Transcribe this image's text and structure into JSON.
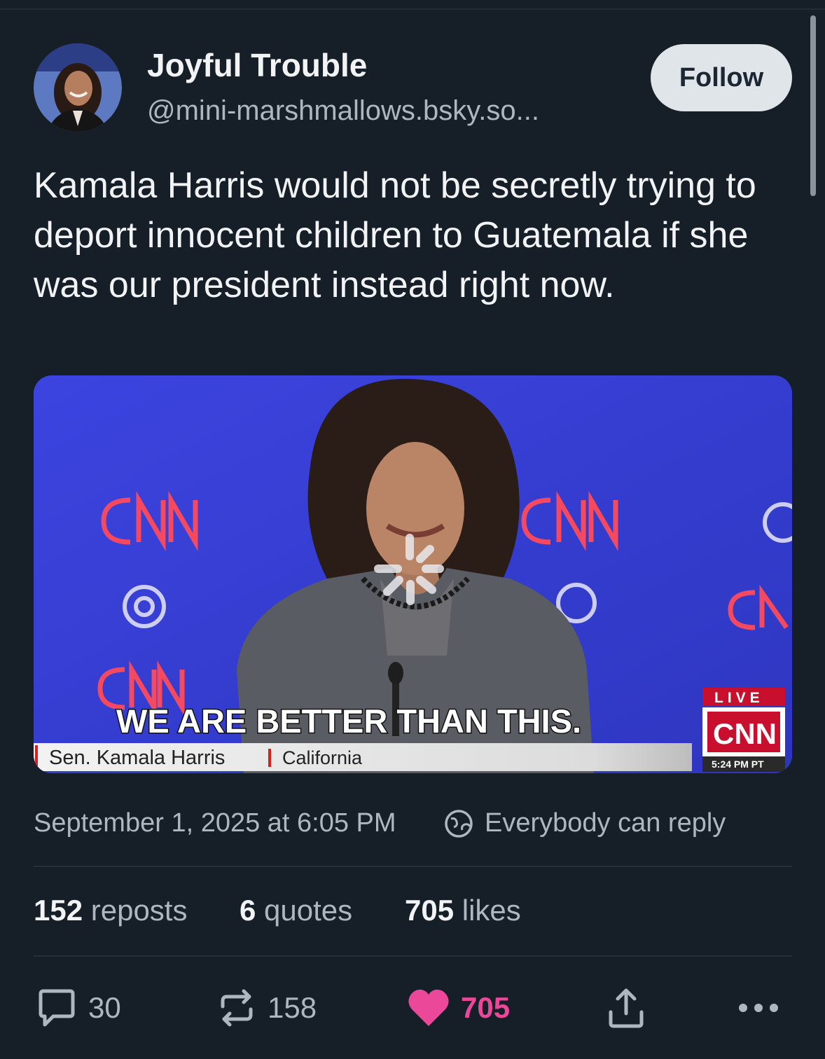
{
  "post": {
    "author_name": "Joyful Trouble",
    "author_handle": "@mini-marshmallows.bsky.so...",
    "follow_label": "Follow",
    "text": "Kamala Harris would not be secretly trying to deport innocent children to Guatemala if she was our president instead right now.",
    "timestamp": "September 1, 2025 at 6:05 PM",
    "reply_setting": "Everybody can reply"
  },
  "media": {
    "caption": "WE ARE BETTER THAN THIS.",
    "chyron_name": "Sen. Kamala Harris",
    "chyron_location": "California",
    "live_label": "LIVE",
    "network_logo": "CNN",
    "time_label": "5:24 PM PT"
  },
  "stats": {
    "reposts_count": "152",
    "reposts_label": "reposts",
    "quotes_count": "6",
    "quotes_label": "quotes",
    "likes_count": "705",
    "likes_label": "likes"
  },
  "actions": {
    "reply_count": "30",
    "repost_count": "158",
    "like_count": "705"
  },
  "icons": [
    "reply-icon",
    "repost-icon",
    "heart-icon",
    "share-icon",
    "more-icon",
    "globe-icon",
    "loading-spinner-icon"
  ],
  "colors": {
    "background": "#161e27",
    "like_active": "#ec4899",
    "follow_button_bg": "#e0e5ea",
    "secondary_text": "#aeb7c0"
  }
}
